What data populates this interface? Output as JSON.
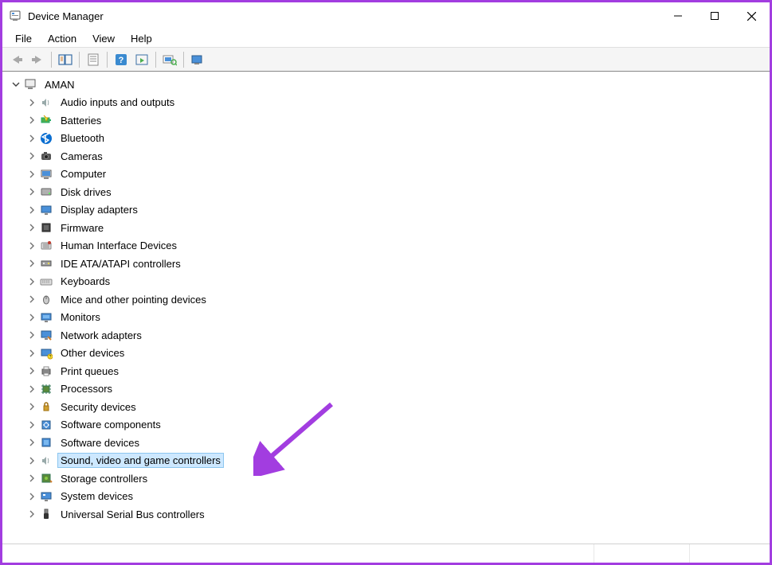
{
  "window": {
    "title": "Device Manager"
  },
  "menubar": {
    "items": [
      "File",
      "Action",
      "View",
      "Help"
    ]
  },
  "toolbar": {
    "buttons": [
      {
        "id": "back",
        "name": "back-icon"
      },
      {
        "id": "forward",
        "name": "forward-icon"
      },
      {
        "id": "sep"
      },
      {
        "id": "show-hide",
        "name": "show-hide-console-icon"
      },
      {
        "id": "sep"
      },
      {
        "id": "properties",
        "name": "properties-icon"
      },
      {
        "id": "sep"
      },
      {
        "id": "help",
        "name": "help-icon"
      },
      {
        "id": "actions",
        "name": "actions-icon"
      },
      {
        "id": "sep"
      },
      {
        "id": "scan",
        "name": "scan-hardware-icon"
      },
      {
        "id": "sep"
      },
      {
        "id": "add-hardware",
        "name": "add-hardware-icon"
      }
    ]
  },
  "tree": {
    "root": {
      "label": "AMAN",
      "expanded": true,
      "icon": "computer"
    },
    "children": [
      {
        "label": "Audio inputs and outputs",
        "icon": "speaker"
      },
      {
        "label": "Batteries",
        "icon": "battery"
      },
      {
        "label": "Bluetooth",
        "icon": "bluetooth"
      },
      {
        "label": "Cameras",
        "icon": "camera"
      },
      {
        "label": "Computer",
        "icon": "computer"
      },
      {
        "label": "Disk drives",
        "icon": "disk"
      },
      {
        "label": "Display adapters",
        "icon": "display"
      },
      {
        "label": "Firmware",
        "icon": "firmware"
      },
      {
        "label": "Human Interface Devices",
        "icon": "hid"
      },
      {
        "label": "IDE ATA/ATAPI controllers",
        "icon": "ide"
      },
      {
        "label": "Keyboards",
        "icon": "keyboard"
      },
      {
        "label": "Mice and other pointing devices",
        "icon": "mouse"
      },
      {
        "label": "Monitors",
        "icon": "monitor"
      },
      {
        "label": "Network adapters",
        "icon": "network"
      },
      {
        "label": "Other devices",
        "icon": "other"
      },
      {
        "label": "Print queues",
        "icon": "printer"
      },
      {
        "label": "Processors",
        "icon": "cpu"
      },
      {
        "label": "Security devices",
        "icon": "security"
      },
      {
        "label": "Software components",
        "icon": "softcomp"
      },
      {
        "label": "Software devices",
        "icon": "softdev"
      },
      {
        "label": "Sound, video and game controllers",
        "icon": "speaker",
        "selected": true
      },
      {
        "label": "Storage controllers",
        "icon": "storage"
      },
      {
        "label": "System devices",
        "icon": "system"
      },
      {
        "label": "Universal Serial Bus controllers",
        "icon": "usb"
      }
    ]
  },
  "colors": {
    "accent_border": "#a23de0",
    "selection_bg": "#cde8ff",
    "arrow_annotation": "#a23de0"
  }
}
